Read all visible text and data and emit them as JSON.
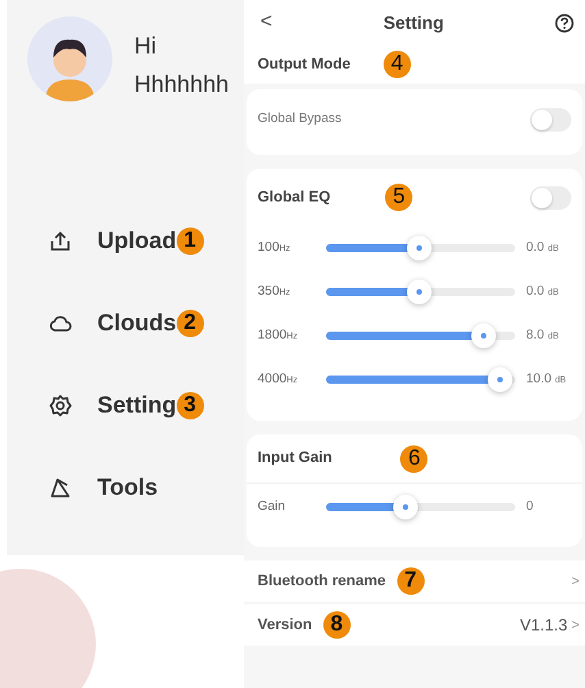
{
  "sidebar": {
    "greeting": "Hi",
    "username": "Hhhhhhh",
    "items": [
      {
        "label": "Upload",
        "badge": "1"
      },
      {
        "label": "Clouds",
        "badge": "2"
      },
      {
        "label": "Setting",
        "badge": "3"
      },
      {
        "label": "Tools"
      }
    ]
  },
  "header": {
    "back": "<",
    "title": "Setting"
  },
  "output_mode": {
    "title": "Output Mode",
    "badge": "4",
    "rows": [
      {
        "label": "Global Bypass",
        "on": false
      }
    ]
  },
  "global_eq": {
    "title": "Global EQ",
    "badge": "5",
    "on": false,
    "bands": [
      {
        "freq": "100",
        "unit": "Hz",
        "level": 0.49,
        "value": "0.0",
        "value_unit": "dB"
      },
      {
        "freq": "350",
        "unit": "Hz",
        "level": 0.49,
        "value": "0.0",
        "value_unit": "dB"
      },
      {
        "freq": "1800",
        "unit": "Hz",
        "level": 0.83,
        "value": "8.0",
        "value_unit": "dB"
      },
      {
        "freq": "4000",
        "unit": "Hz",
        "level": 0.92,
        "value": "10.0",
        "value_unit": "dB"
      }
    ]
  },
  "input_gain": {
    "title": "Input Gain",
    "badge": "6",
    "rows": [
      {
        "label": "Gain",
        "level": 0.42,
        "value": "0"
      }
    ]
  },
  "links": [
    {
      "label": "Bluetooth rename",
      "badge": "7",
      "chevron": ">"
    },
    {
      "label": "Version",
      "badge": "8",
      "value": "V1.1.3",
      "chevron": ">"
    }
  ]
}
